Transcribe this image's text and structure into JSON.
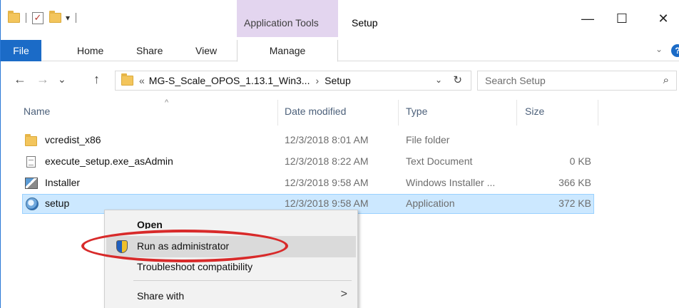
{
  "titlebar": {
    "context_tab_title": "Application Tools",
    "window_title": "Setup",
    "controls": {
      "minimize": "—",
      "maximize": "☐",
      "close": "✕"
    }
  },
  "ribbon": {
    "tabs": [
      "File",
      "Home",
      "Share",
      "View",
      "Manage"
    ],
    "help": "?"
  },
  "nav": {
    "back": "←",
    "forward": "→",
    "recent": "⌄",
    "up": "↑",
    "address_prefix": "«",
    "address_path": "MG-S_Scale_OPOS_1.13.1_Win3...",
    "address_current": "Setup",
    "address_sep": "›",
    "search_placeholder": "Search Setup"
  },
  "columns": [
    "Name",
    "Date modified",
    "Type",
    "Size"
  ],
  "files": [
    {
      "name": "vcredist_x86",
      "date": "12/3/2018 8:01 AM",
      "type": "File folder",
      "size": "",
      "icon": "folder-icon"
    },
    {
      "name": "execute_setup.exe_asAdmin",
      "date": "12/3/2018 8:22 AM",
      "type": "Text Document",
      "size": "0 KB",
      "icon": "document-icon"
    },
    {
      "name": "Installer",
      "date": "12/3/2018 9:58 AM",
      "type": "Windows Installer ...",
      "size": "366 KB",
      "icon": "installer-icon"
    },
    {
      "name": "setup",
      "date": "12/3/2018 9:58 AM",
      "type": "Application",
      "size": "372 KB",
      "icon": "setup-app-icon"
    }
  ],
  "context_menu": {
    "open": "Open",
    "run_as_admin": "Run as administrator",
    "troubleshoot": "Troubleshoot compatibility",
    "share_with": "Share with",
    "submenu_chevron": ">"
  },
  "colors": {
    "file_tab": "#1b6bc7",
    "context_tab": "#e3d5ef",
    "selection": "#cce8ff",
    "annotation": "#d82a2a"
  }
}
